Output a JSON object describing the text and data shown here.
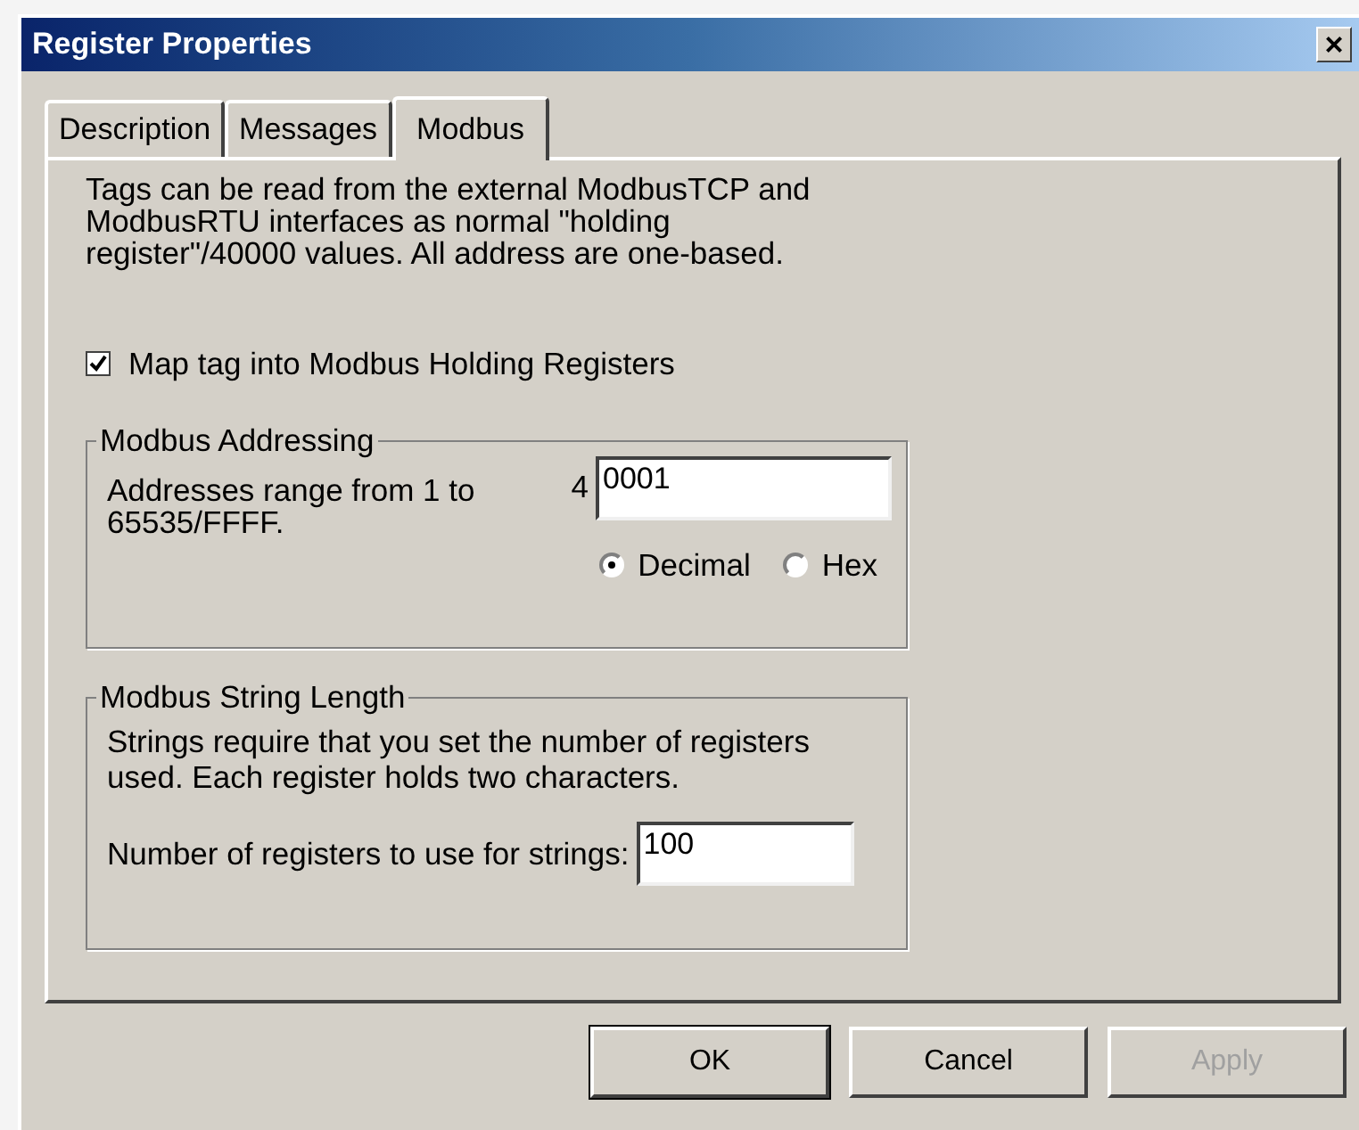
{
  "window": {
    "title": "Register Properties",
    "close": "×"
  },
  "tabs": [
    {
      "label": "Description",
      "selected": false
    },
    {
      "label": "Messages",
      "selected": false
    },
    {
      "label": "Modbus",
      "selected": true
    }
  ],
  "intro": "Tags can be read from the external ModbusTCP and ModbusRTU interfaces as normal \"holding register\"/40000 values.  All address are one-based.",
  "map_checkbox": {
    "label": "Map tag into Modbus Holding Registers",
    "checked": true
  },
  "addressing": {
    "title": "Modbus Addressing",
    "description": "Addresses range from 1 to 65535/FFFF.",
    "prefix": "4",
    "value": "0001",
    "radios": [
      {
        "label": "Decimal",
        "selected": true
      },
      {
        "label": "Hex",
        "selected": false
      }
    ]
  },
  "string_length": {
    "title": "Modbus String Length",
    "description": "Strings require that you set the number of registers used.  Each register holds two characters.",
    "label": "Number of registers to use for strings:",
    "value": "100"
  },
  "buttons": [
    {
      "label": "OK",
      "disabled": false,
      "default": true
    },
    {
      "label": "Cancel",
      "disabled": false,
      "default": false
    },
    {
      "label": "Apply",
      "disabled": true,
      "default": false
    }
  ]
}
